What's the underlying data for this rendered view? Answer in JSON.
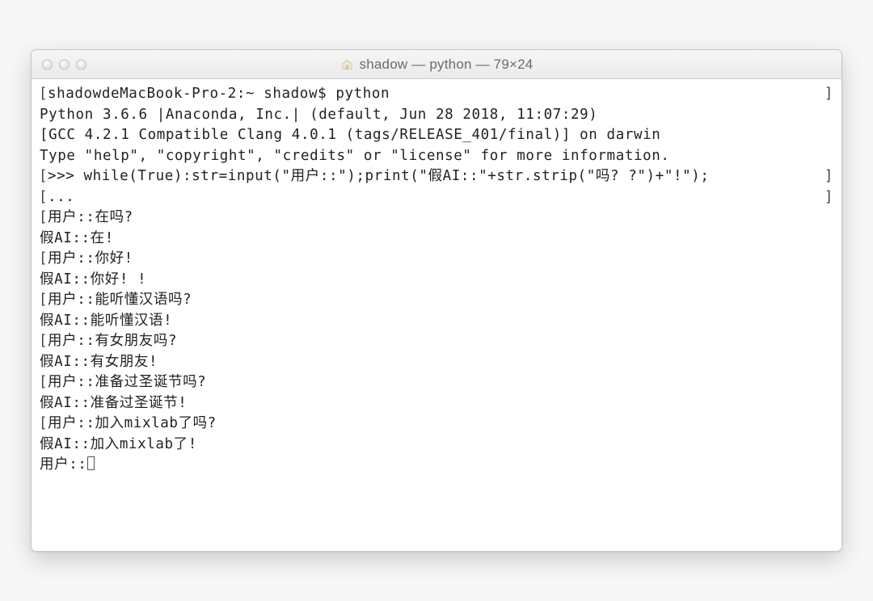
{
  "window": {
    "title": "shadow — python — 79×24"
  },
  "terminal": {
    "lines": [
      {
        "text": "shadowdeMacBook-Pro-2:~ shadow$ python",
        "lead": true,
        "trail": true
      },
      {
        "text": "Python 3.6.6 |Anaconda, Inc.| (default, Jun 28 2018, 11:07:29)",
        "lead": false,
        "trail": false
      },
      {
        "text": "[GCC 4.2.1 Compatible Clang 4.0.1 (tags/RELEASE_401/final)] on darwin",
        "lead": false,
        "trail": false
      },
      {
        "text": "Type \"help\", \"copyright\", \"credits\" or \"license\" for more information.",
        "lead": false,
        "trail": false
      },
      {
        "text": ">>> while(True):str=input(\"用户::\");print(\"假AI::\"+str.strip(\"吗? ?\")+\"!\");",
        "lead": true,
        "trail": true
      },
      {
        "text": "...",
        "lead": true,
        "trail": true
      },
      {
        "text": "用户::在吗?",
        "lead": true,
        "trail": false
      },
      {
        "text": "假AI::在!",
        "lead": false,
        "trail": false
      },
      {
        "text": "用户::你好!",
        "lead": true,
        "trail": false
      },
      {
        "text": "假AI::你好! !",
        "lead": false,
        "trail": false
      },
      {
        "text": "用户::能听懂汉语吗?",
        "lead": true,
        "trail": false
      },
      {
        "text": "假AI::能听懂汉语!",
        "lead": false,
        "trail": false
      },
      {
        "text": "用户::有女朋友吗?",
        "lead": true,
        "trail": false
      },
      {
        "text": "假AI::有女朋友!",
        "lead": false,
        "trail": false
      },
      {
        "text": "用户::准备过圣诞节吗?",
        "lead": true,
        "trail": false
      },
      {
        "text": "假AI::准备过圣诞节!",
        "lead": false,
        "trail": false
      },
      {
        "text": "用户::加入mixlab了吗?",
        "lead": true,
        "trail": false
      },
      {
        "text": "假AI::加入mixlab了!",
        "lead": false,
        "trail": false
      }
    ],
    "prompt_label": "用户::"
  }
}
